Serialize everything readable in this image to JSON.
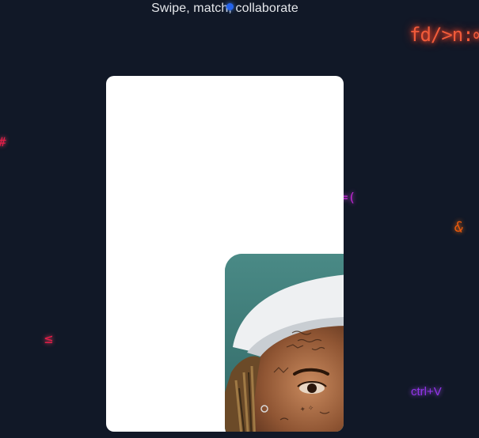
{
  "header": {
    "tagline": "Swipe, match, collaborate"
  },
  "background_glyphs": [
    {
      "text": "fd/>n:∞",
      "color": "#f25b3a"
    },
    {
      "text": "#",
      "color": "#e11d48"
    },
    {
      "text": "=(",
      "color": "#c026d3"
    },
    {
      "text": "&",
      "color": "#ea580c"
    },
    {
      "text": "≤",
      "color": "#e11d48"
    },
    {
      "text": "ctrl+V",
      "color": "#9333ea"
    }
  ],
  "card": {
    "background": "#ffffff",
    "photo_bg": "#3f7d7b"
  },
  "colors": {
    "page_bg": "#111827",
    "accent_dot": "#2563eb"
  }
}
